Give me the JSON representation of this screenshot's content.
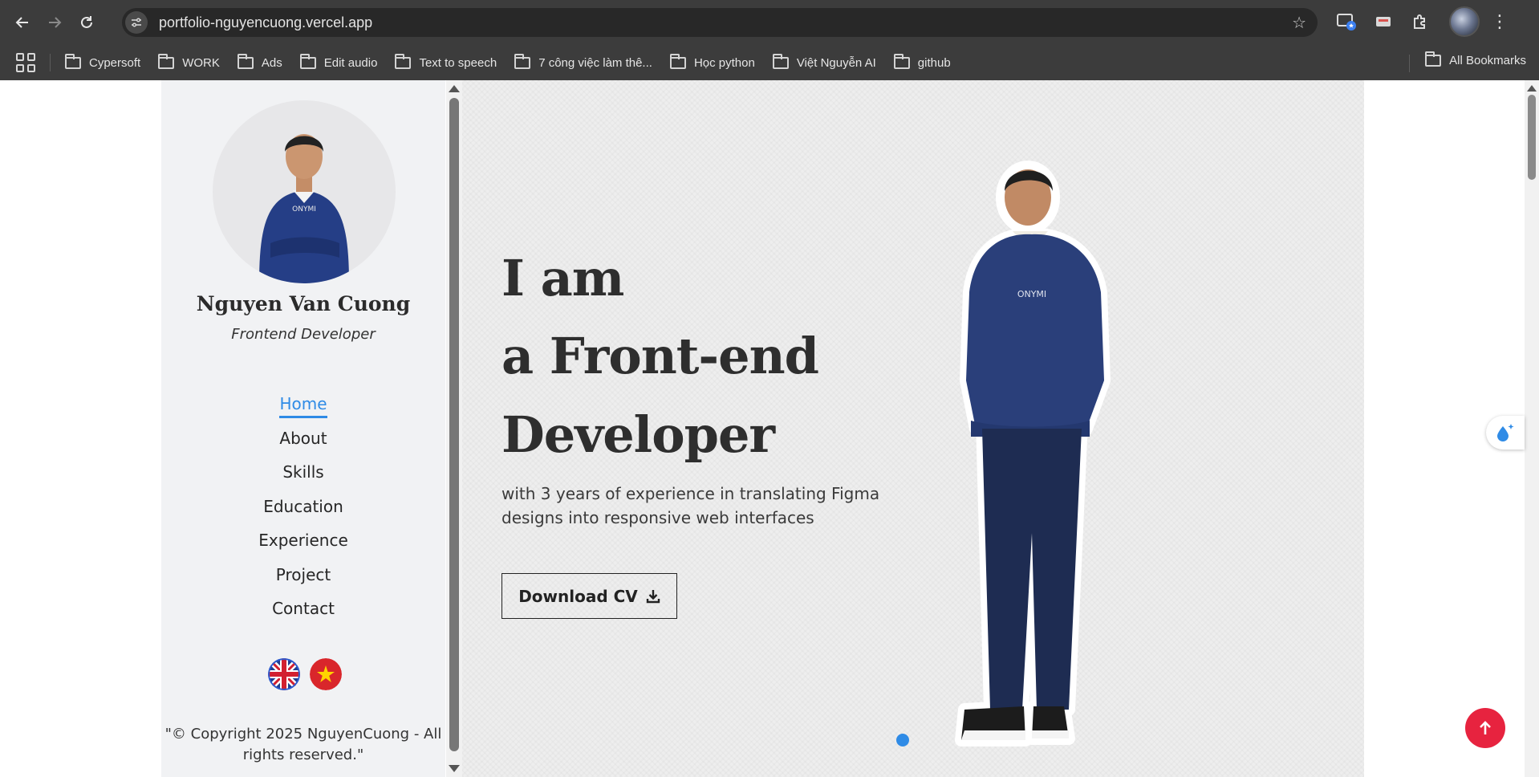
{
  "browser": {
    "url": "portfolio-nguyencuong.vercel.app",
    "bookmarks": [
      "Cypersoft",
      "WORK",
      "Ads",
      "Edit audio",
      "Text to speech",
      "7 công việc làm thê...",
      "Học python",
      "Việt Nguyễn AI",
      "github"
    ],
    "all_bookmarks": "All Bookmarks"
  },
  "sidebar": {
    "name": "Nguyen Van Cuong",
    "role": "Frontend Developer",
    "menu": [
      "Home",
      "About",
      "Skills",
      "Education",
      "Experience",
      "Project",
      "Contact"
    ],
    "active_menu": "Home",
    "copyright": "\"© Copyright 2025 NguyenCuong - All rights reserved.\""
  },
  "hero": {
    "line1": "I am",
    "line2": "a Front-end",
    "line3": "Developer",
    "subtitle": "with 3 years of experience in translating Figma designs into responsive web interfaces",
    "cta": "Download CV"
  },
  "colors": {
    "accent": "#2f8be6",
    "back_to_top": "#e7233f",
    "sidebar_bg": "#f1f2f4",
    "hero_bg": "#eeeeee"
  }
}
